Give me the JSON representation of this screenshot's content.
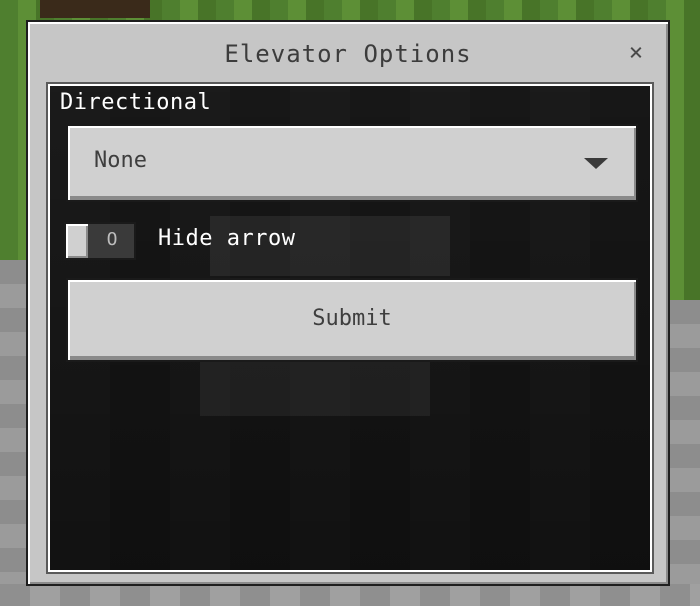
{
  "dialog": {
    "title": "Elevator Options",
    "close_glyph": "×"
  },
  "directional": {
    "label": "Directional",
    "selected_value": "None",
    "arrow_icon": "chevron-down-icon"
  },
  "hide_arrow": {
    "label": "Hide arrow",
    "state_glyph": "O",
    "enabled": false
  },
  "submit": {
    "label": "Submit"
  },
  "colors": {
    "panel": "#c6c6c6",
    "button": "#d0d0d0",
    "content_bg": "#363636",
    "text_light": "#ffffff",
    "text_dark": "#3e3e3e"
  }
}
